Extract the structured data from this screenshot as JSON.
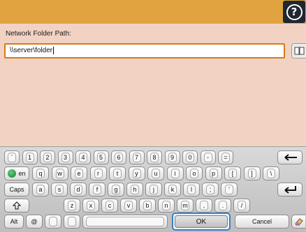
{
  "header": {
    "help_icon_glyph": "?"
  },
  "form": {
    "label": "Network Folder Path:",
    "value": "\\\\server\\folder"
  },
  "keyboard": {
    "row1": [
      "`",
      "1",
      "2",
      "3",
      "4",
      "5",
      "6",
      "7",
      "8",
      "9",
      "0",
      "-",
      "="
    ],
    "row2": [
      "q",
      "w",
      "e",
      "r",
      "t",
      "y",
      "u",
      "i",
      "o",
      "p",
      "[",
      "]",
      "\\"
    ],
    "row3": [
      "a",
      "s",
      "d",
      "f",
      "g",
      "h",
      "j",
      "k",
      "l",
      ";",
      "'"
    ],
    "row4": [
      "z",
      "x",
      "c",
      "v",
      "b",
      "n",
      "m",
      ",",
      ".",
      "/"
    ],
    "lang_label": "en",
    "caps_label": "Caps",
    "alt_label": "Alt",
    "at_label": "@",
    "ok_label": "OK",
    "cancel_label": "Cancel"
  },
  "colors": {
    "header": "#e0a33f",
    "background": "#f2d3c3",
    "input_border": "#d47a1f",
    "ok_focus": "#3a7fc4"
  }
}
